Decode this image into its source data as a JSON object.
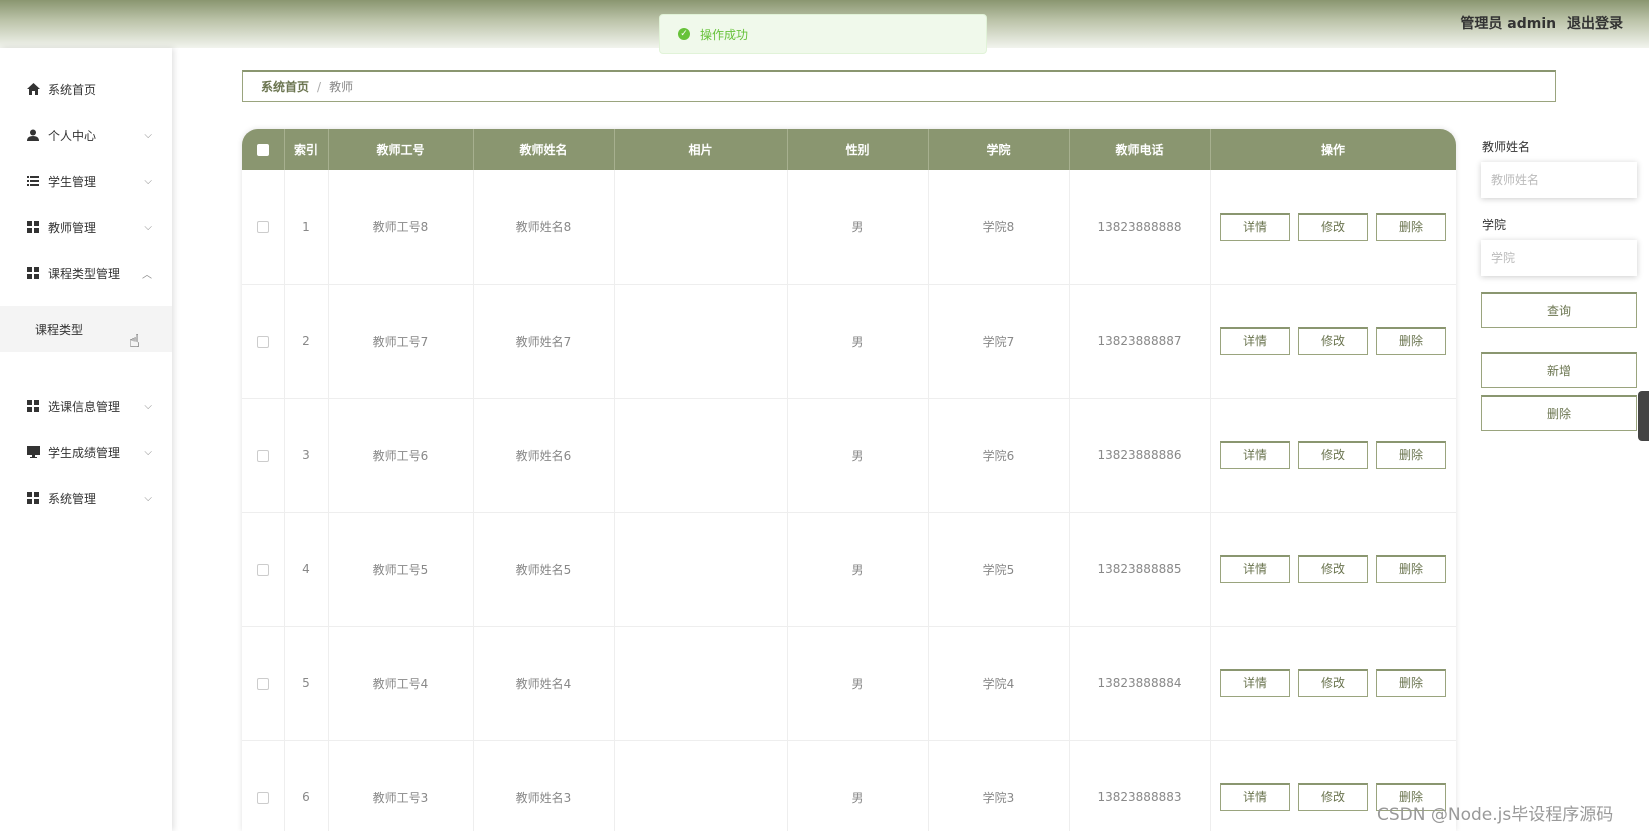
{
  "header": {
    "user_label": "管理员 admin",
    "logout_label": "退出登录"
  },
  "toast": {
    "message": "操作成功"
  },
  "sidebar": {
    "items": [
      {
        "label": "系统首页"
      },
      {
        "label": "个人中心"
      },
      {
        "label": "学生管理"
      },
      {
        "label": "教师管理"
      },
      {
        "label": "课程类型管理"
      },
      {
        "label": "选课信息管理"
      },
      {
        "label": "学生成绩管理"
      },
      {
        "label": "系统管理"
      }
    ],
    "submenu_item": "课程类型"
  },
  "breadcrumb": {
    "home": "系统首页",
    "separator": "/",
    "current": "教师"
  },
  "table": {
    "headers": [
      "索引",
      "教师工号",
      "教师姓名",
      "相片",
      "性别",
      "学院",
      "教师电话",
      "操作"
    ],
    "rows": [
      {
        "index": "1",
        "id": "教师工号8",
        "name": "教师姓名8",
        "photo": "",
        "gender": "男",
        "college": "学院8",
        "phone": "13823888888"
      },
      {
        "index": "2",
        "id": "教师工号7",
        "name": "教师姓名7",
        "photo": "",
        "gender": "男",
        "college": "学院7",
        "phone": "13823888887"
      },
      {
        "index": "3",
        "id": "教师工号6",
        "name": "教师姓名6",
        "photo": "",
        "gender": "男",
        "college": "学院6",
        "phone": "13823888886"
      },
      {
        "index": "4",
        "id": "教师工号5",
        "name": "教师姓名5",
        "photo": "",
        "gender": "男",
        "college": "学院5",
        "phone": "13823888885"
      },
      {
        "index": "5",
        "id": "教师工号4",
        "name": "教师姓名4",
        "photo": "",
        "gender": "男",
        "college": "学院4",
        "phone": "13823888884"
      },
      {
        "index": "6",
        "id": "教师工号3",
        "name": "教师姓名3",
        "photo": "",
        "gender": "男",
        "college": "学院3",
        "phone": "13823888883"
      }
    ],
    "actions": {
      "detail": "详情",
      "edit": "修改",
      "delete": "删除"
    }
  },
  "search": {
    "name_label": "教师姓名",
    "name_placeholder": "教师姓名",
    "college_label": "学院",
    "college_placeholder": "学院",
    "query_button": "查询",
    "add_button": "新增",
    "delete_button": "删除"
  },
  "watermark": "CSDN @Node.js毕设程序源码",
  "colors": {
    "accent": "#8a9670",
    "toast_green": "#67c23a"
  }
}
